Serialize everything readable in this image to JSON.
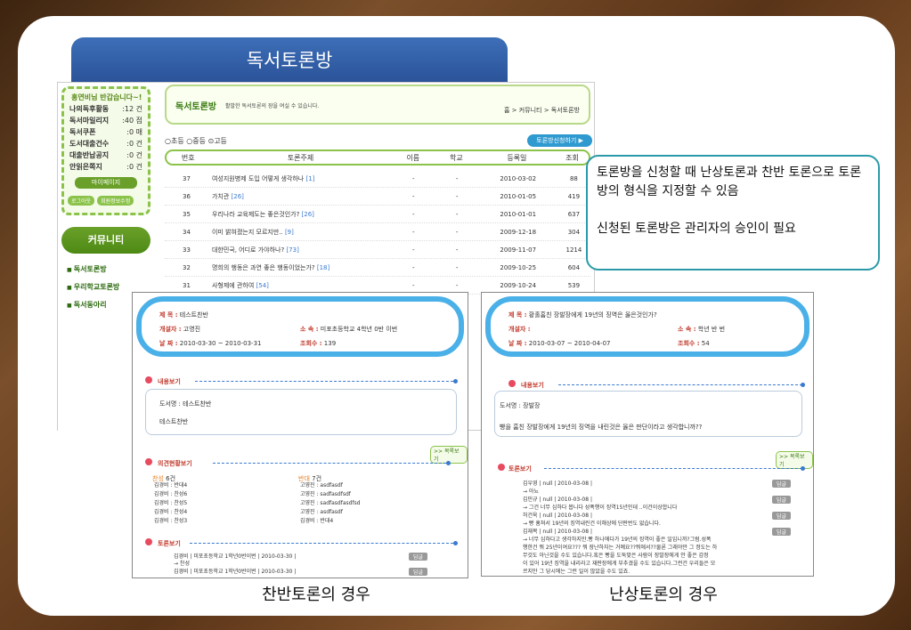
{
  "slide_title": "독서토론방",
  "sidebar": {
    "greeting": "홍연비님 반갑습니다~!",
    "stats": [
      [
        "나의독후활동",
        ":12 건"
      ],
      [
        "독서마일리지",
        ":40 점"
      ],
      [
        "독서쿠폰",
        ":0 매"
      ],
      [
        "도서대출건수",
        ":0 건"
      ],
      [
        "대출반납공지",
        ":0 건"
      ],
      [
        "안읽은쪽지",
        ":0 건"
      ]
    ],
    "mypage": "마이페이지",
    "logout": "로그아웃",
    "edit": "회원정보수정",
    "community": "커뮤니티",
    "menu": [
      "독서토론방",
      "우리학교토론방",
      "독서동아리"
    ]
  },
  "board": {
    "title": "독서토론방",
    "desc": "활발한 독서토론의 장을 여실 수 있습니다.",
    "crumb": "홈 > 커뮤니티 > 독서토론방",
    "radios": "○초등 ○중등 ⊙고등",
    "apply": "토론방신청하기 ▶",
    "columns": [
      "번호",
      "토론주제",
      "이름",
      "학교",
      "등록일",
      "조회"
    ],
    "rows": [
      [
        "37",
        "여성지원병제 도입 어떻게 생각하나",
        "[1]",
        "-",
        "-",
        "2010-03-02",
        "88"
      ],
      [
        "36",
        "가치관",
        "[26]",
        "-",
        "-",
        "2010-01-05",
        "419"
      ],
      [
        "35",
        "우리나라 교육제도는 좋은것인가?",
        "[26]",
        "-",
        "-",
        "2010-01-01",
        "637"
      ],
      [
        "34",
        "이미 밝혀졌는지 모르지만..",
        "[9]",
        "-",
        "-",
        "2009-12-18",
        "304"
      ],
      [
        "33",
        "대한민국, 어디로 가야하나?",
        "[73]",
        "-",
        "-",
        "2009-11-07",
        "1214"
      ],
      [
        "32",
        "명희의 행동은 과연 좋은 행동이었는가?",
        "[18]",
        "-",
        "-",
        "2009-10-25",
        "604"
      ],
      [
        "31",
        "사형제에 관하여",
        "[54]",
        "-",
        "-",
        "2009-10-24",
        "539"
      ]
    ]
  },
  "callout": {
    "line1": "토론방을 신청할 때 난상토론과 찬반 토론으로 토론방의 형식을 지정할 수 있음",
    "line2": "신청된 토론방은 관리자의 승인이 필요"
  },
  "left_detail": {
    "subject_label": "제 목 :",
    "subject": "테스트찬반",
    "creator_label": "개설자 :",
    "creator": "고영진",
    "school_label": "소 속 :",
    "school": "미포초등학교 4학년 0반 이번",
    "date_label": "날 짜 :",
    "date": "2010-03-30 ~ 2010-03-31",
    "views_label": "조회수 :",
    "views": "139",
    "content_title": "내용보기",
    "book": "도서명 : 테스트찬반",
    "body": "테스트찬반",
    "more": ">> 목록보기",
    "vote_title": "의견현황보기",
    "pro_label": "찬성",
    "pro_count": "6건",
    "con_label": "반대",
    "con_count": "7건",
    "pro": [
      "김경비 : 반대4",
      "김경비 : 찬성6",
      "김경비 : 찬성5",
      "김경비 : 찬성4",
      "김경비 : 찬성3"
    ],
    "con": [
      "고영진 : asdfasdf",
      "고영진 : sadfasdfsdf",
      "고영진 : sadfasdfasdfsd",
      "고영진 : asdfasdf",
      "김경비 : 반대4"
    ],
    "debate_title": "토론보기",
    "comments": [
      "김경비 | 미포초등학교 1학년0반이번 | 2010-03-30 |",
      "→ 찬성",
      "김경비 | 미포초등학교 1학년0반이번 | 2010-03-30 |"
    ],
    "reply": "답글"
  },
  "right_detail": {
    "subject_label": "제 목 :",
    "subject": "황홀홈친 장발장에게 19년의 징역은 옳은것인가?",
    "creator_label": "개설자 :",
    "school_label": "소 속 :",
    "school": "학년 반 번",
    "date_label": "날 짜 :",
    "date": "2010-03-07 ~ 2010-04-07",
    "views_label": "조회수 :",
    "views": "54",
    "content_title": "내용보기",
    "book": "도서명 : 장발장",
    "body": "빵을 훔친 장발장에게 19년의 징역을 내린것은 옳은 판단이라고 생각합니까??",
    "more": ">> 목록보기",
    "debate_title": "토론보기",
    "comments": [
      "김우영 | null | 2010-03-08 |",
      "→ 아뇨",
      "김민규 | null | 2010-03-08 |",
      "→ 그건 너무 심하다 봅니다 성폭행이 징역15년인데 ..이건이상합니다",
      "허건욱 | null | 2010-03-08 |",
      "→ 빵 훔쳐서 19년의 징역내린건 이해상에 단판번도 없습니다.",
      "김재복 | null | 2010-03-08 |",
      "→ 너무 심하다고 생각하지만.빵 하나에다가 19년의 징역이 좋은 일입니까?그럼.성폭",
      "행한건 뭐 25년이여요??? 뭐 장난하자는 거예요??뭐에서??물론 그래야만 그 정도는 하",
      "무것도 아닌것을 수도 있습니다.혹은 빵을 도둑맞은 사람이 장발장에게 안 좋은 감정",
      "이 있어 19년 징역을 내리라고 재판장에게 부추겼을 수도 있습니다.그런건 우리들은 모",
      "르지만 그 당시에는 그런 일이 많았을 수도 있죠."
    ],
    "reply": "답글"
  },
  "captions": [
    "찬반토론의 경우",
    "난상토론의 경우"
  ]
}
